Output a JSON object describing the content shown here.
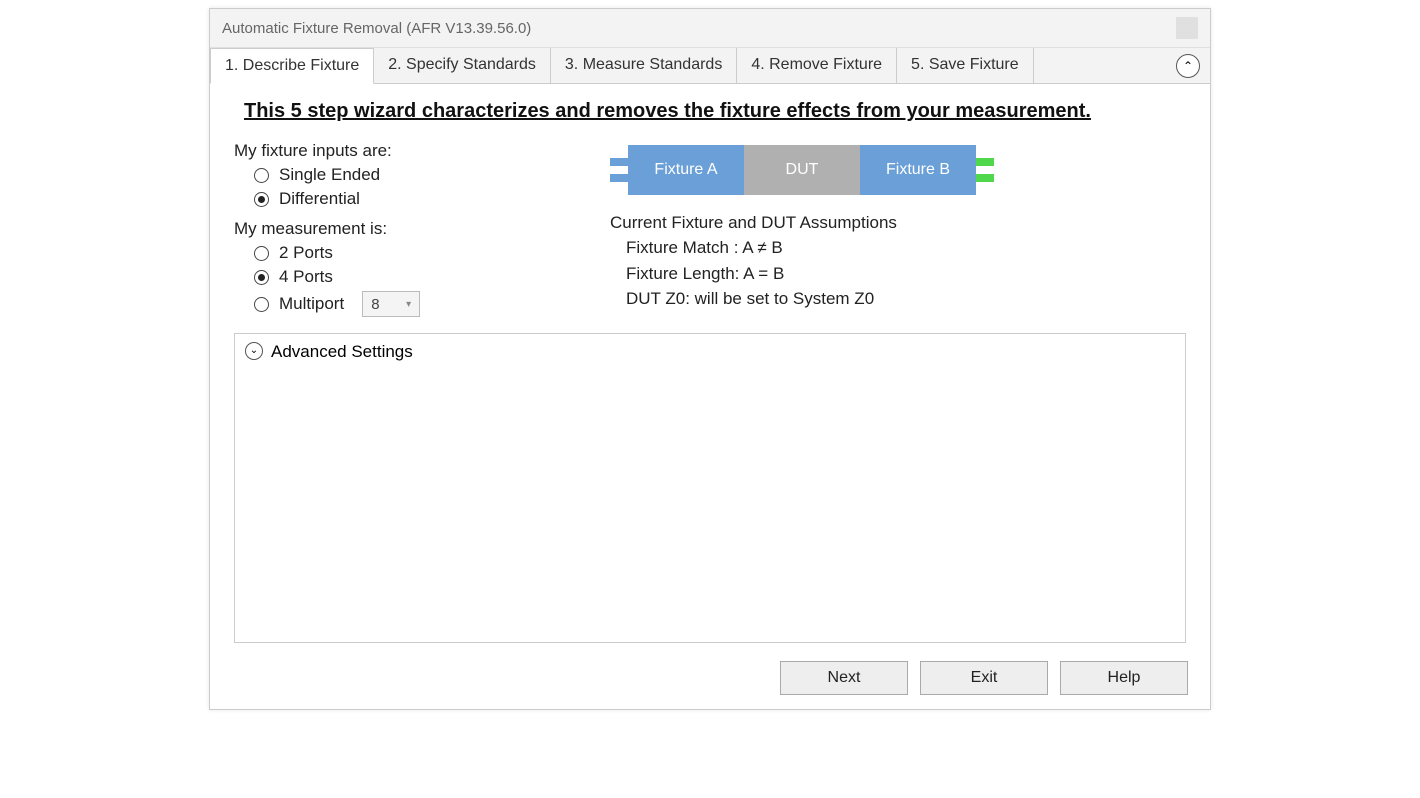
{
  "window": {
    "title": "Automatic Fixture Removal (AFR V13.39.56.0)"
  },
  "tabs": [
    {
      "label": "1. Describe Fixture",
      "active": true
    },
    {
      "label": "2. Specify Standards",
      "active": false
    },
    {
      "label": "3. Measure Standards",
      "active": false
    },
    {
      "label": "4. Remove Fixture",
      "active": false
    },
    {
      "label": "5. Save Fixture",
      "active": false
    }
  ],
  "page": {
    "headline": "This 5 step wizard characterizes and removes the fixture effects from your measurement.",
    "inputs_label": "My fixture inputs are:",
    "input_options": {
      "single_ended": "Single Ended",
      "differential": "Differential"
    },
    "input_selected": "differential",
    "measure_label": "My measurement is:",
    "measure_options": {
      "two_ports": "2 Ports",
      "four_ports": "4 Ports",
      "multiport": "Multiport"
    },
    "measure_selected": "four_ports",
    "multiport_value": "8",
    "diagram": {
      "fixture_a": "Fixture A",
      "dut": "DUT",
      "fixture_b": "Fixture B"
    },
    "assumptions": {
      "title": "Current Fixture and DUT Assumptions",
      "match": "Fixture Match : A ≠ B",
      "length": "Fixture Length: A = B",
      "z0": "DUT Z0: will be set to System Z0"
    },
    "advanced_label": "Advanced Settings"
  },
  "buttons": {
    "next": "Next",
    "exit": "Exit",
    "help": "Help"
  }
}
